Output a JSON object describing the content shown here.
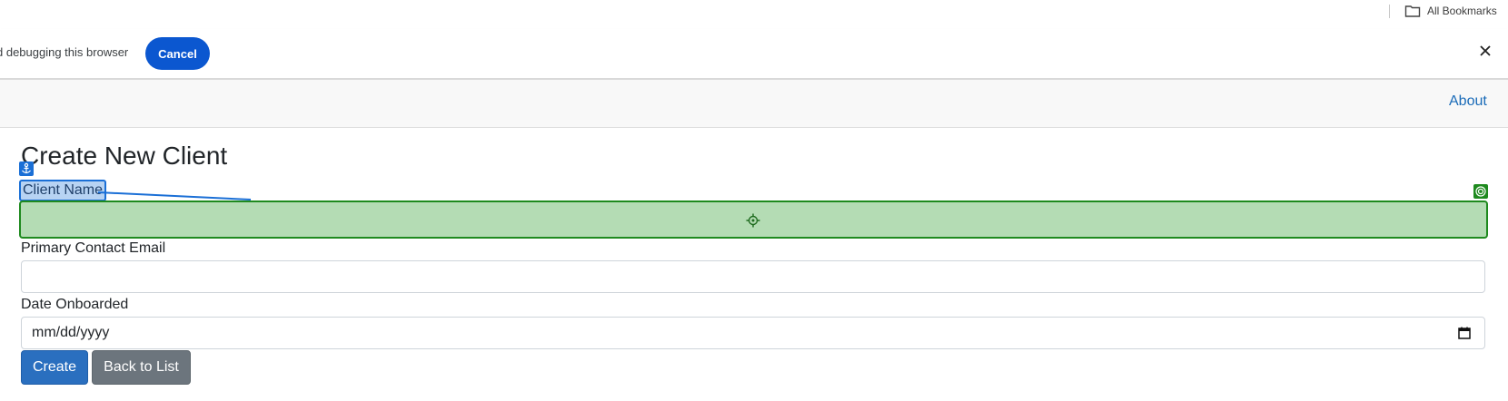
{
  "bookmarks_bar": {
    "all_bookmarks_label": "All Bookmarks",
    "folder_icon": "folder-icon"
  },
  "infobar": {
    "message": "d debugging this browser",
    "cancel_label": "Cancel",
    "close_icon": "close-icon"
  },
  "navbar": {
    "about_label": "About"
  },
  "form": {
    "title": "Create New Client",
    "client_name_label": "Client Name",
    "client_name_value": "",
    "email_label": "Primary Contact Email",
    "email_value": "",
    "date_label": "Date Onboarded",
    "date_value": "mm/dd/yyyy",
    "create_label": "Create",
    "back_label": "Back to List"
  },
  "colors": {
    "brand_blue": "#0b57d0",
    "primary_button": "#2a6fbf",
    "secondary_button": "#6c757d",
    "highlight_green": "#b4dcb4",
    "highlight_blue": "#b7d3f3"
  }
}
